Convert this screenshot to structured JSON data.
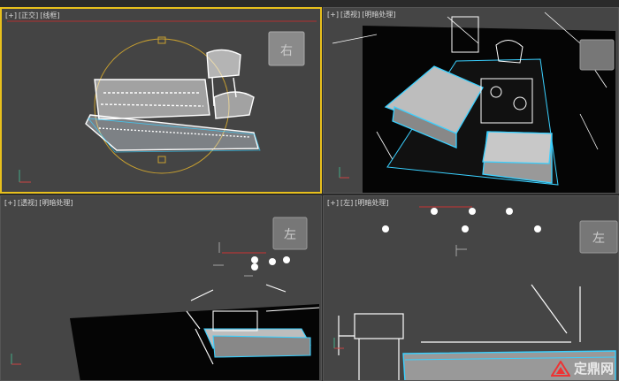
{
  "viewports": [
    {
      "id": "front",
      "labels": [
        "[+]",
        "[正交]",
        "[线框]"
      ],
      "viewcube_face": "右",
      "active": true
    },
    {
      "id": "persp1",
      "labels": [
        "[+]",
        "[透视]",
        "[明暗处理]"
      ],
      "viewcube_face": "",
      "active": false
    },
    {
      "id": "persp2",
      "labels": [
        "[+]",
        "[透视]",
        "[明暗处理]"
      ],
      "viewcube_face": "左",
      "active": false
    },
    {
      "id": "left",
      "labels": [
        "[+]",
        "[左]",
        "[明暗处理]"
      ],
      "viewcube_face": "左",
      "active": false
    }
  ],
  "axes": {
    "x": "x",
    "y": "y",
    "z": "z"
  },
  "watermark": {
    "text": "定鼎网"
  },
  "colors": {
    "background": "#454545",
    "dark_bg": "#2e2e2e",
    "active_border": "#e8c01c",
    "wire_white": "#ffffff",
    "wire_cyan": "#3ad0ff",
    "gizmo": "#c8a030"
  }
}
